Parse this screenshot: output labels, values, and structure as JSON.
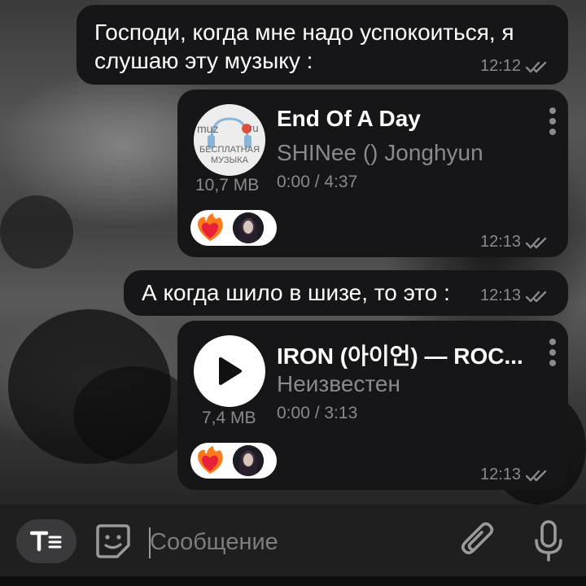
{
  "messages": [
    {
      "text_line1": "Господи, когда мне надо успокоиться, я",
      "text_line2": "слушаю эту музыку :",
      "time": "12:12"
    },
    {
      "audio": {
        "title": "End Of A Day",
        "artist": "SHINee () Jonghyun",
        "progress": "0:00 / 4:37",
        "size": "10,7 MB",
        "thumb_text_top": "muz",
        "thumb_text_ru": "ru",
        "thumb_text_line1": "БЕСПЛАТНАЯ",
        "thumb_text_line2": "МУЗЫКА"
      },
      "time": "12:13"
    },
    {
      "text_line1": "А когда шило в шизе, то это :",
      "time": "12:13"
    },
    {
      "audio": {
        "title": "IRON (아이언) — ROC...",
        "artist": "Неизвестен",
        "progress": "0:00 / 3:13",
        "size": "7,4 MB"
      },
      "time": "12:13"
    }
  ],
  "input": {
    "placeholder": "Сообщение"
  },
  "icons": {
    "format": "text-format-icon",
    "sticker": "sticker-icon",
    "attach": "paperclip-icon",
    "mic": "microphone-icon",
    "play": "play-icon",
    "reaction": "heart-on-fire-icon",
    "read": "double-check-icon",
    "menu": "more-vertical-icon"
  },
  "colors": {
    "bubble": "#161618",
    "meta": "#8a8a8e",
    "input_bar": "#1f1f1f"
  }
}
